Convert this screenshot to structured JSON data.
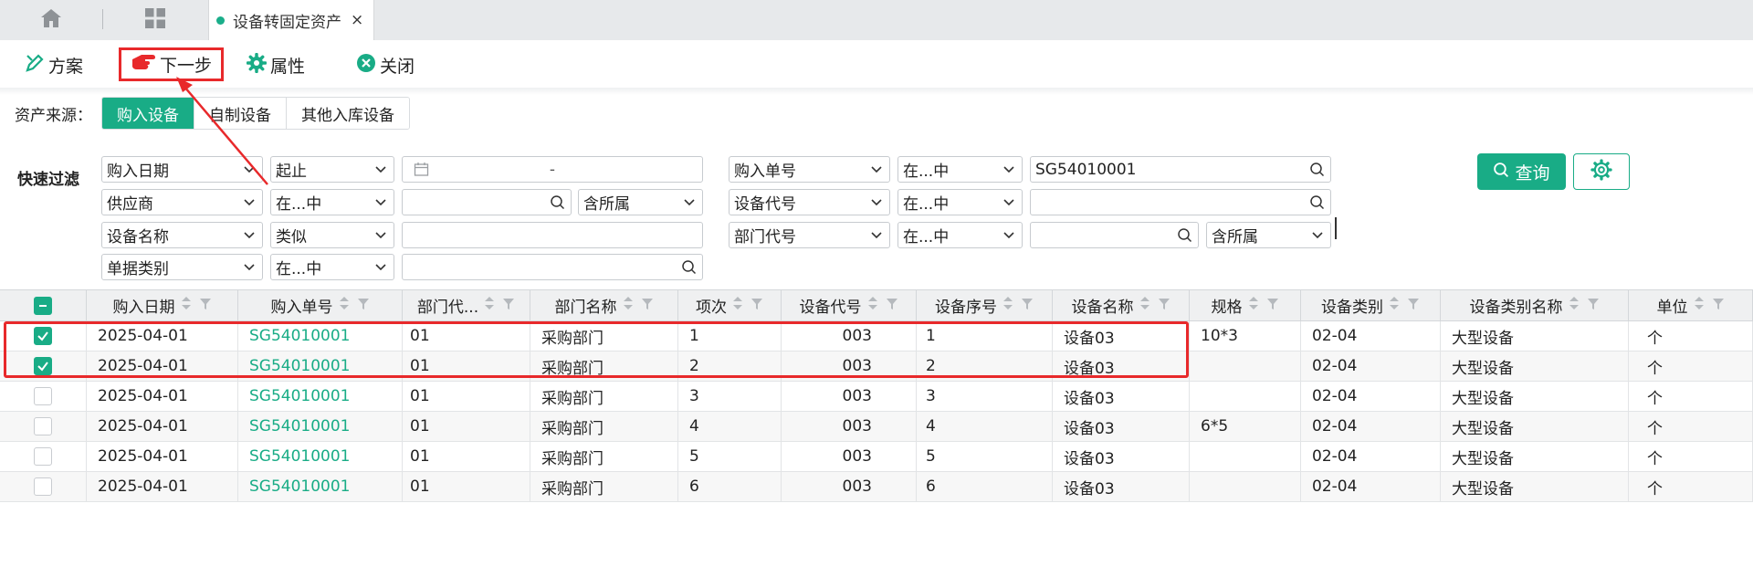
{
  "tabs": {
    "home_icon": "home-icon",
    "grid_icon": "apps-grid-icon",
    "active_label": "设备转固定资产",
    "close_glyph": "×"
  },
  "toolbar": {
    "fangan": "方案",
    "next": "下一步",
    "attr": "属性",
    "close": "关闭"
  },
  "source": {
    "label": "资产来源：",
    "options": [
      "购入设备",
      "自制设备",
      "其他入库设备"
    ],
    "selected": "购入设备"
  },
  "filters": {
    "label": "快速过滤",
    "row1": {
      "field1": "购入日期",
      "op1": "起止",
      "date_sep": "-",
      "field2": "购入单号",
      "op2": "在...中",
      "value2": "SG54010001"
    },
    "row2": {
      "field1": "供应商",
      "op1": "在...中",
      "value1": "",
      "scope1": "含所属",
      "field2": "设备代号",
      "op2": "在...中",
      "value2": ""
    },
    "row3": {
      "field1": "设备名称",
      "op1": "类似",
      "value1": "",
      "field2": "部门代号",
      "op2": "在...中",
      "value2": "",
      "scope2": "含所属"
    },
    "row4": {
      "field1": "单据类别",
      "op1": "在...中",
      "value1": ""
    }
  },
  "buttons": {
    "query": "查询"
  },
  "colors": {
    "accent": "#19ac86",
    "highlight": "#e8292b"
  },
  "table": {
    "columns": [
      "购入日期",
      "购入单号",
      "部门代...",
      "部门名称",
      "项次",
      "设备代号",
      "设备序号",
      "设备名称",
      "规格",
      "设备类别",
      "设备类别名称",
      "单位"
    ],
    "rows": [
      {
        "checked": true,
        "cells": [
          "2025-04-01",
          "SG54010001",
          "01",
          "采购部门",
          "1",
          "003",
          "1",
          "设备03",
          "10*3",
          "02-04",
          "大型设备",
          "个"
        ]
      },
      {
        "checked": true,
        "cells": [
          "2025-04-01",
          "SG54010001",
          "01",
          "采购部门",
          "2",
          "003",
          "2",
          "设备03",
          "",
          "02-04",
          "大型设备",
          "个"
        ]
      },
      {
        "checked": false,
        "cells": [
          "2025-04-01",
          "SG54010001",
          "01",
          "采购部门",
          "3",
          "003",
          "3",
          "设备03",
          "",
          "02-04",
          "大型设备",
          "个"
        ]
      },
      {
        "checked": false,
        "cells": [
          "2025-04-01",
          "SG54010001",
          "01",
          "采购部门",
          "4",
          "003",
          "4",
          "设备03",
          "6*5",
          "02-04",
          "大型设备",
          "个"
        ]
      },
      {
        "checked": false,
        "cells": [
          "2025-04-01",
          "SG54010001",
          "01",
          "采购部门",
          "5",
          "003",
          "5",
          "设备03",
          "",
          "02-04",
          "大型设备",
          "个"
        ]
      },
      {
        "checked": false,
        "cells": [
          "2025-04-01",
          "SG54010001",
          "01",
          "采购部门",
          "6",
          "003",
          "6",
          "设备03",
          "",
          "02-04",
          "大型设备",
          "个"
        ]
      }
    ]
  }
}
